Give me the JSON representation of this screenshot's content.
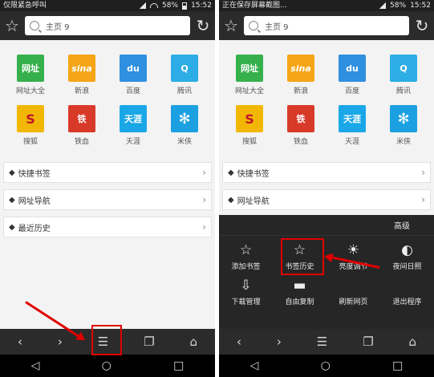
{
  "left": {
    "status": {
      "left": "仅限紧急呼叫",
      "battery": "58%",
      "time": "15:52"
    },
    "search": {
      "value": "主页 9"
    },
    "apps": [
      {
        "label": "网址大全",
        "tile": "网址",
        "color": "#35b04b"
      },
      {
        "label": "新浪",
        "tile": "sina",
        "color": "#f5a516"
      },
      {
        "label": "百度",
        "tile": "du",
        "color": "#2f8fe0"
      },
      {
        "label": "腾讯",
        "tile": "Q",
        "color": "#2dade5"
      },
      {
        "label": "搜狐",
        "tile": "S",
        "color": "#f2b705"
      },
      {
        "label": "铁血",
        "tile": "铁",
        "color": "#d83a2a"
      },
      {
        "label": "天涯",
        "tile": "天涯",
        "color": "#1aa7e8"
      },
      {
        "label": "米侠",
        "tile": "✻",
        "color": "#1ba0e2"
      }
    ],
    "rows": [
      "快捷书签",
      "网址导航",
      "最近历史"
    ]
  },
  "right": {
    "status": {
      "left": "正在保存屏幕截图...",
      "battery": "58%",
      "time": "15:52"
    },
    "search": {
      "value": "主页 9"
    },
    "apps": [
      {
        "label": "网址大全",
        "tile": "网址",
        "color": "#35b04b"
      },
      {
        "label": "新浪",
        "tile": "sina",
        "color": "#f5a516"
      },
      {
        "label": "百度",
        "tile": "du",
        "color": "#2f8fe0"
      },
      {
        "label": "腾讯",
        "tile": "Q",
        "color": "#2dade5"
      },
      {
        "label": "搜狐",
        "tile": "S",
        "color": "#f2b705"
      },
      {
        "label": "铁血",
        "tile": "铁",
        "color": "#d83a2a"
      },
      {
        "label": "天涯",
        "tile": "天涯",
        "color": "#1aa7e8"
      },
      {
        "label": "米侠",
        "tile": "✻",
        "color": "#1ba0e2"
      }
    ],
    "rows": [
      "快捷书签",
      "网址导航"
    ],
    "menu": {
      "header": "高级",
      "items": [
        {
          "label": "添加书签",
          "icon": "☆"
        },
        {
          "label": "书签历史",
          "icon": "☆"
        },
        {
          "label": "亮度调节",
          "icon": "☀"
        },
        {
          "label": "夜间日照",
          "icon": "◐"
        },
        {
          "label": "下载管理",
          "icon": "⇩"
        },
        {
          "label": "自由复制",
          "icon": "▬"
        },
        {
          "label": "刷新网页",
          "icon": ""
        },
        {
          "label": "退出程序",
          "icon": ""
        }
      ]
    }
  },
  "nav_icons": {
    "back": "‹",
    "forward": "›",
    "menu": "☰",
    "tabs": "❐",
    "home": "⌂"
  },
  "sys_icons": {
    "back": "◁",
    "home": "○",
    "recent": "□"
  }
}
